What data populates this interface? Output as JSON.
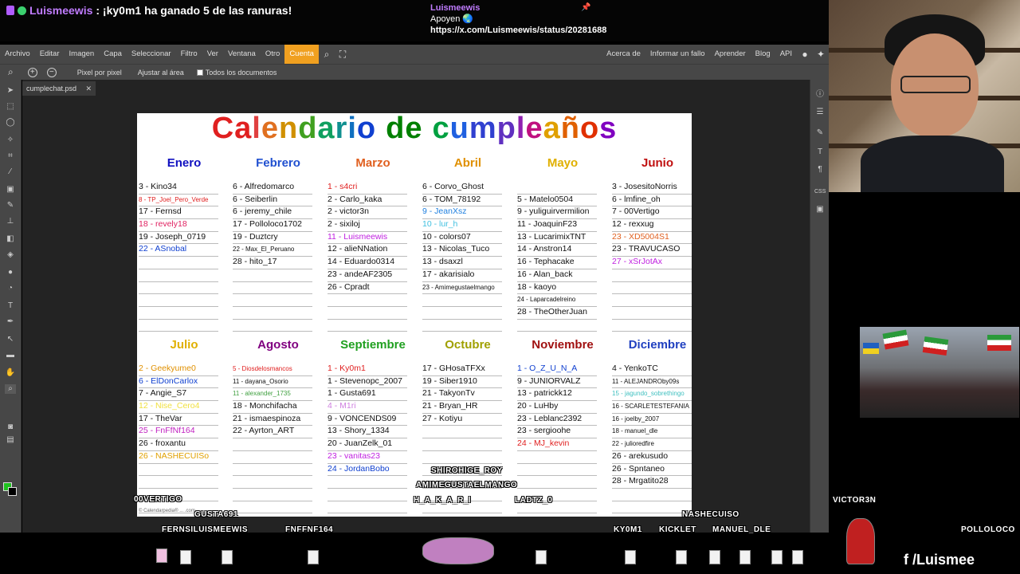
{
  "stream": {
    "chat_top": {
      "user": "Luismeewis",
      "message": ": ¡ky0m1 ha ganado 5 de las ranuras!"
    },
    "chat_pinned": {
      "user": "Luismeewis",
      "line1": "Apoyen 🌏",
      "line2": "https://x.com/Luismeewis/status/20281688"
    },
    "social": "/Luismee"
  },
  "menu": {
    "items": [
      "Archivo",
      "Editar",
      "Imagen",
      "Capa",
      "Seleccionar",
      "Filtro",
      "Ver",
      "Ventana",
      "Otro",
      "Cuenta"
    ],
    "right_items": [
      "Acerca de",
      "Informar un fallo",
      "Aprender",
      "Blog",
      "API"
    ]
  },
  "options": {
    "pixel": "Pixel por pixel",
    "fit": "Ajustar al área",
    "all_docs": "Todos los documentos"
  },
  "doc_tab": {
    "name": "cumplechat.psd",
    "close": "✕"
  },
  "calendar": {
    "title_letters": [
      "C",
      "a",
      "l",
      "e",
      "n",
      "d",
      "a",
      "r",
      "i",
      "o",
      " ",
      "d",
      "e",
      " ",
      "c",
      "u",
      "m",
      "p",
      "l",
      "e",
      "a",
      "ñ",
      "o",
      "s"
    ],
    "title_colors": [
      "#e02020",
      "#e02020",
      "#e04040",
      "#e07020",
      "#d09000",
      "#40a020",
      "#10a060",
      "#109090",
      "#1070c0",
      "#1040d0",
      "#000",
      "#008000",
      "#008000",
      "#000",
      "#00a040",
      "#2060e0",
      "#3040d0",
      "#6030c0",
      "#9020b0",
      "#c01080",
      "#e0a000",
      "#e06000",
      "#e03000",
      "#8000c0"
    ],
    "months": [
      {
        "name": "Enero",
        "color": "#1010c0",
        "entries": [
          {
            "t": "3 - Kino34",
            "c": "#111"
          },
          {
            "t": "8 - TP_Joel_Pero_Verde",
            "c": "#e02020",
            "small": true
          },
          {
            "t": "17 - Fernsd",
            "c": "#111"
          },
          {
            "t": "18 - revely18",
            "c": "#e02060"
          },
          {
            "t": "19 - Joseph_0719",
            "c": "#111"
          },
          {
            "t": "22 - ASnobal",
            "c": "#1040d0"
          }
        ]
      },
      {
        "name": "Febrero",
        "color": "#2050d0",
        "entries": [
          {
            "t": "6 - Alfredomarco",
            "c": "#111"
          },
          {
            "t": "6 - Seiberlin",
            "c": "#111"
          },
          {
            "t": "6 - jeremy_chile",
            "c": "#111"
          },
          {
            "t": "17 - Polloloco1702",
            "c": "#111"
          },
          {
            "t": "19 - Duztcry",
            "c": "#111"
          },
          {
            "t": "22 - Max_El_Peruano",
            "c": "#111",
            "small": true
          },
          {
            "t": "28 - hito_17",
            "c": "#111"
          }
        ]
      },
      {
        "name": "Marzo",
        "color": "#e06020",
        "entries": [
          {
            "t": "1 - s4cri",
            "c": "#e02020"
          },
          {
            "t": "2 - Carlo_kaka",
            "c": "#111"
          },
          {
            "t": "2 - victor3n",
            "c": "#111"
          },
          {
            "t": "2 - sixiloj",
            "c": "#111"
          },
          {
            "t": "11 - Luismeewis",
            "c": "#c020e0"
          },
          {
            "t": "12 - alieNNation",
            "c": "#111"
          },
          {
            "t": "14 - Eduardo0314",
            "c": "#111"
          },
          {
            "t": "23 - andeAF2305",
            "c": "#111"
          },
          {
            "t": "26 - Cpradt",
            "c": "#111"
          }
        ]
      },
      {
        "name": "Abril",
        "color": "#e09000",
        "entries": [
          {
            "t": "6 - Corvo_Ghost",
            "c": "#111"
          },
          {
            "t": "6 - TOM_78192",
            "c": "#111"
          },
          {
            "t": "9 - JeanXsz",
            "c": "#2080e0"
          },
          {
            "t": "10 - lur_h",
            "c": "#40c0e0"
          },
          {
            "t": "10 - colors07",
            "c": "#111"
          },
          {
            "t": "13 - Nicolas_Tuco",
            "c": "#111"
          },
          {
            "t": "13 - dsaxzl",
            "c": "#111"
          },
          {
            "t": "17 - akarisialo",
            "c": "#111"
          },
          {
            "t": "23 - Amimegustaelmango",
            "c": "#111",
            "small": true
          }
        ]
      },
      {
        "name": "Mayo",
        "color": "#e0b000",
        "entries": [
          {
            "t": "",
            "c": "#111"
          },
          {
            "t": "5 - Matelo0504",
            "c": "#111"
          },
          {
            "t": "9 - yuliguirvermilion",
            "c": "#111"
          },
          {
            "t": "11 - JoaquinF23",
            "c": "#111"
          },
          {
            "t": "13 - LucarimixTNT",
            "c": "#111"
          },
          {
            "t": "14 - Anstron14",
            "c": "#111"
          },
          {
            "t": "16 - Tephacake",
            "c": "#111"
          },
          {
            "t": "16 - Alan_back",
            "c": "#111"
          },
          {
            "t": "18 - kaoyo",
            "c": "#111"
          },
          {
            "t": "24 - Laparcadelreino",
            "c": "#111",
            "small": true
          },
          {
            "t": "28 - TheOtherJuan",
            "c": "#111"
          }
        ]
      },
      {
        "name": "Junio",
        "color": "#c01010",
        "entries": [
          {
            "t": "3 - JosesitoNorris",
            "c": "#111"
          },
          {
            "t": "6 - lmfine_oh",
            "c": "#111"
          },
          {
            "t": "7 - 00Vertigo",
            "c": "#111"
          },
          {
            "t": "12 - rexxug",
            "c": "#111"
          },
          {
            "t": "23 - XD5004S1",
            "c": "#e06020"
          },
          {
            "t": "23 - TRAVUCASO",
            "c": "#111"
          },
          {
            "t": "27 - xSrJotAx",
            "c": "#c020e0"
          }
        ]
      },
      {
        "name": "Julio",
        "color": "#e0b000",
        "entries": [
          {
            "t": "2 - Geekyume0",
            "c": "#e09000"
          },
          {
            "t": "6 - ElDonCarlox",
            "c": "#1040d0"
          },
          {
            "t": "7 - Angie_S7",
            "c": "#111"
          },
          {
            "t": "12 - Nise_Cero4",
            "c": "#f0e040"
          },
          {
            "t": "17 - TheVar",
            "c": "#111"
          },
          {
            "t": "25 - FnFfNf164",
            "c": "#c020c0"
          },
          {
            "t": "26 - froxantu",
            "c": "#111"
          },
          {
            "t": "26 - NASHECUISo",
            "c": "#e0a000"
          }
        ]
      },
      {
        "name": "Agosto",
        "color": "#800080",
        "entries": [
          {
            "t": "5 - Diosdelosmancos",
            "c": "#e02020",
            "small": true
          },
          {
            "t": "11 - dayana_Osorio",
            "c": "#111",
            "small": true
          },
          {
            "t": "11 - alexander_1735",
            "c": "#40a040",
            "small": true
          },
          {
            "t": "18 - Monchifacha",
            "c": "#111"
          },
          {
            "t": "21 - ismaespinoza",
            "c": "#111"
          },
          {
            "t": "22 - Ayrton_ART",
            "c": "#111"
          }
        ]
      },
      {
        "name": "Septiembre",
        "color": "#20a020",
        "entries": [
          {
            "t": "1 - Ky0m1",
            "c": "#e02020"
          },
          {
            "t": "1 - Stevenopc_2007",
            "c": "#111"
          },
          {
            "t": "1 - Gusta691",
            "c": "#111"
          },
          {
            "t": "4 - M1ri",
            "c": "#d080e0"
          },
          {
            "t": "9 - VONCENDS09",
            "c": "#111"
          },
          {
            "t": "13 - Shory_1334",
            "c": "#111"
          },
          {
            "t": "20 - JuanZelk_01",
            "c": "#111"
          },
          {
            "t": "23 - vanitas23",
            "c": "#c020e0"
          },
          {
            "t": "24 - JordanBobo",
            "c": "#1040d0"
          }
        ]
      },
      {
        "name": "Octubre",
        "color": "#a0a000",
        "entries": [
          {
            "t": "17 - GHosaTFXx",
            "c": "#111"
          },
          {
            "t": "19 - Siber1910",
            "c": "#111"
          },
          {
            "t": "21 - TakyonTv",
            "c": "#111"
          },
          {
            "t": "21 - Bryan_HR",
            "c": "#111"
          },
          {
            "t": "27 - Kotiyu",
            "c": "#111"
          }
        ]
      },
      {
        "name": "Noviembre",
        "color": "#a01010",
        "entries": [
          {
            "t": "1 - O_Z_U_N_A",
            "c": "#1040d0"
          },
          {
            "t": "9 - JUNIORVALZ",
            "c": "#111"
          },
          {
            "t": "13 - patrickk12",
            "c": "#111"
          },
          {
            "t": "20 - LuHby",
            "c": "#111"
          },
          {
            "t": "23 - Leblanc2392",
            "c": "#111"
          },
          {
            "t": "23 - sergioohe",
            "c": "#111"
          },
          {
            "t": "24 - MJ_kevin",
            "c": "#e02020"
          }
        ]
      },
      {
        "name": "Diciembre",
        "color": "#2040c0",
        "entries": [
          {
            "t": "4 - YenkoTC",
            "c": "#111"
          },
          {
            "t": "11 - ALEJANDROby09s",
            "c": "#111",
            "small": true
          },
          {
            "t": "15 - jagundo_sobrethingo",
            "c": "#40c0c0",
            "small": true
          },
          {
            "t": "16 - SCARLETESTEFANIA",
            "c": "#111",
            "small": true
          },
          {
            "t": "16 - joelby_2007",
            "c": "#111",
            "small": true
          },
          {
            "t": "18 - manuel_dle",
            "c": "#111",
            "small": true
          },
          {
            "t": "22 - julioredfire",
            "c": "#111",
            "small": true
          },
          {
            "t": "26 - arekusudo",
            "c": "#111"
          },
          {
            "t": "26 - Spntaneo",
            "c": "#111"
          },
          {
            "t": "28 - Mrgatito28",
            "c": "#111"
          }
        ]
      }
    ],
    "footer": "© Calendarpedia® ... .com"
  },
  "overlay_names": [
    {
      "id": "00vertigo",
      "t": "00VERTIGO"
    },
    {
      "id": "gusta691",
      "t": "GUSTA691"
    },
    {
      "id": "fernsiluis",
      "t": "FERNSILUISMEEWIS"
    },
    {
      "id": "fnffnf",
      "t": "FNFFNF164"
    },
    {
      "id": "shirohige",
      "t": "SHIROHIGE_ROY"
    },
    {
      "id": "amimegusta",
      "t": "AMIMEGUSTAELMANGO"
    },
    {
      "id": "hakari",
      "t": "H_A_K_A_R_I"
    },
    {
      "id": "ladtz",
      "t": "LADTZ_0"
    },
    {
      "id": "ky0m1",
      "t": "KY0M1"
    },
    {
      "id": "kicklet",
      "t": "KICKLET"
    },
    {
      "id": "manuel",
      "t": "MANUEL_DLE"
    },
    {
      "id": "nashecuiso",
      "t": "NASHECUISO"
    },
    {
      "id": "victor3n",
      "t": "VICTOR3N"
    },
    {
      "id": "polloloco",
      "t": "POLLOLOCO"
    }
  ]
}
